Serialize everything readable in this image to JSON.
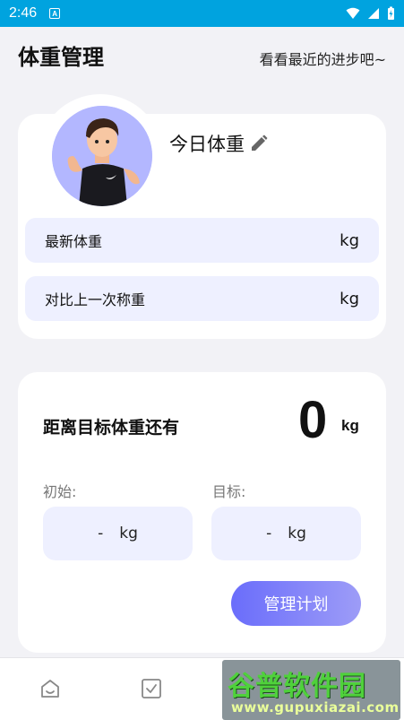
{
  "status_bar": {
    "time": "2:46",
    "app_badge": "A"
  },
  "header": {
    "title": "体重管理",
    "subtitle": "看看最近的进步吧~"
  },
  "today_card": {
    "today_label": "今日体重",
    "rows": [
      {
        "label": "最新体重",
        "unit": "kg"
      },
      {
        "label": "对比上一次称重",
        "unit": "kg"
      }
    ]
  },
  "goal_card": {
    "title": "距离目标体重还有",
    "remaining_value": "0",
    "remaining_unit": "kg",
    "initial": {
      "label": "初始:",
      "value": "-",
      "unit": "kg"
    },
    "target": {
      "label": "目标:",
      "value": "-",
      "unit": "kg"
    },
    "plan_button": "管理计划"
  },
  "watermark": {
    "brand": "谷普软件园",
    "url": "www.gupuxiazai.com"
  },
  "colors": {
    "status_bar": "#00a3df",
    "page_bg": "#f2f2f6",
    "row_bg": "#eef0ff",
    "avatar_bg": "#b3b7ff",
    "button_gradient_start": "#6a6dfb",
    "button_gradient_end": "#9d9cf7"
  },
  "icons": {
    "edit": "pencil-icon",
    "nav_home": "home-icon",
    "nav_checklist": "checkbox-icon"
  }
}
